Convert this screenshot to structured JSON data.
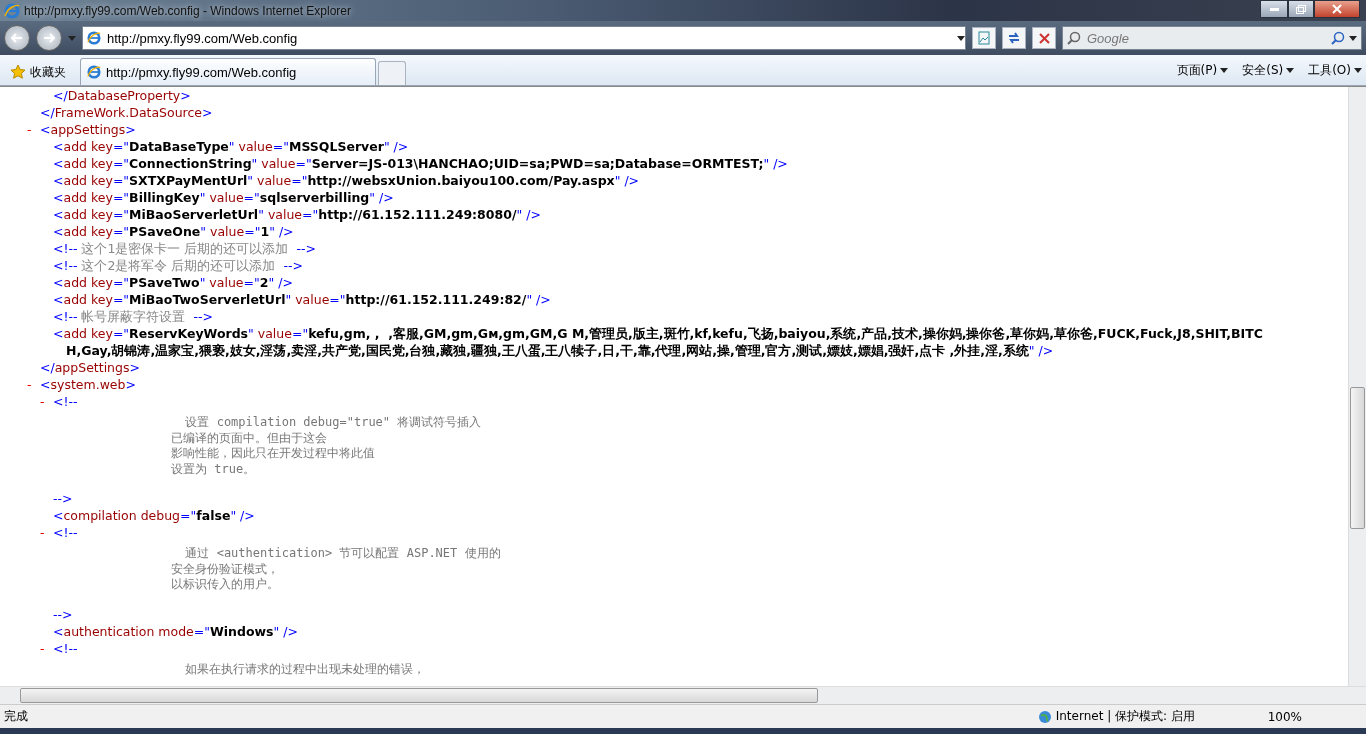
{
  "window": {
    "title": "http://pmxy.fly99.com/Web.config - Windows Internet Explorer"
  },
  "address_bar": {
    "value": "http://pmxy.fly99.com/Web.config"
  },
  "search": {
    "placeholder": "Google"
  },
  "favorites": {
    "label": "收藏夹"
  },
  "tabs": [
    {
      "label": "http://pmxy.fly99.com/Web.config",
      "selected": true
    }
  ],
  "command_menus": [
    "页面(P)",
    "安全(S)",
    "工具(O)"
  ],
  "document": {
    "nodes": [
      {
        "kind": "tail",
        "close": "</FrameWork.DataSource>",
        "children": [
          {
            "kind": "tag",
            "text": "</DatabaseProperty>"
          }
        ]
      },
      {
        "kind": "element",
        "toggle": "-",
        "open": "<appSettings>",
        "close": "</appSettings>",
        "expanded": true,
        "children": [
          {
            "kind": "tag",
            "text": "<add key=\"DataBaseType\" value=\"MSSQLServer\" />"
          },
          {
            "kind": "tag",
            "text": "<add key=\"ConnectionString\" value=\"Server=JS-013\\HANCHAO;UID=sa;PWD=sa;Database=ORMTEST;\" />"
          },
          {
            "kind": "tag",
            "text": "<add key=\"SXTXPayMentUrl\" value=\"http://websxUnion.baiyou100.com/Pay.aspx\" />"
          },
          {
            "kind": "tag",
            "text": "<add key=\"BillingKey\" value=\"sqlserverbilling\" />"
          },
          {
            "kind": "tag",
            "text": "<add key=\"MiBaoServerletUrl\" value=\"http://61.152.111.249:8080/\" />"
          },
          {
            "kind": "tag",
            "text": "<add key=\"PSaveOne\" value=\"1\" />"
          },
          {
            "kind": "comment",
            "text": "<!-- 这个1是密保卡一 后期的还可以添加  -->"
          },
          {
            "kind": "comment",
            "text": "<!-- 这个2是将军令 后期的还可以添加  -->"
          },
          {
            "kind": "tag",
            "text": "<add key=\"PSaveTwo\" value=\"2\" />"
          },
          {
            "kind": "tag",
            "text": "<add key=\"MiBaoTwoServerletUrl\" value=\"http://61.152.111.249:82/\" />"
          },
          {
            "kind": "comment",
            "text": "<!-- 帐号屏蔽字符设置  -->"
          },
          {
            "kind": "tag",
            "text": "<add key=\"ReservKeyWords\" value=\"kefu,gm, ,  ,客服,GM,gm,Gм,gm,GM,G M,管理员,版主,斑竹,kf,kefu,飞扬,baiyou,系统,产品,技术,操你妈,操你爸,草你妈,草你爸,FUCK,Fuck,J8,SHIT,BITCH,Gay,胡锦涛,温家宝,猥亵,妓女,淫荡,卖淫,共产党,国民党,台独,藏独,疆独,王八蛋,王八犊子,日,干,靠,代理,网站,操,管理,官方,测试,嫖妓,嫖娼,强奸,点卡 ,外挂,淫,系统\" />"
          }
        ]
      },
      {
        "kind": "element",
        "toggle": "-",
        "open": "<system.web>",
        "expanded": true,
        "children": [
          {
            "kind": "block_comment",
            "toggle": "-",
            "open": "<!--",
            "close": "-->",
            "expanded": true,
            "lines": [
              "  设置 compilation debug=\"true\" 将调试符号插入",
              "已编译的页面中。但由于这会",
              "影响性能，因此只在开发过程中将此值",
              "设置为 true。"
            ]
          },
          {
            "kind": "tag",
            "text": "<compilation debug=\"false\" />"
          },
          {
            "kind": "block_comment",
            "toggle": "-",
            "open": "<!--",
            "close": "-->",
            "expanded": true,
            "lines": [
              "  通过 <authentication> 节可以配置 ASP.NET 使用的",
              "安全身份验证模式，",
              "以标识传入的用户。"
            ]
          },
          {
            "kind": "tag",
            "text": "<authentication mode=\"Windows\" />"
          },
          {
            "kind": "block_comment",
            "toggle": "-",
            "open": "<!--",
            "expanded": true,
            "lines": [
              "  如果在执行请求的过程中出现未处理的错误，"
            ]
          }
        ]
      }
    ]
  },
  "status_bar": {
    "text": "完成",
    "zone": "Internet | 保护模式: 启用",
    "zoom": "100%"
  }
}
